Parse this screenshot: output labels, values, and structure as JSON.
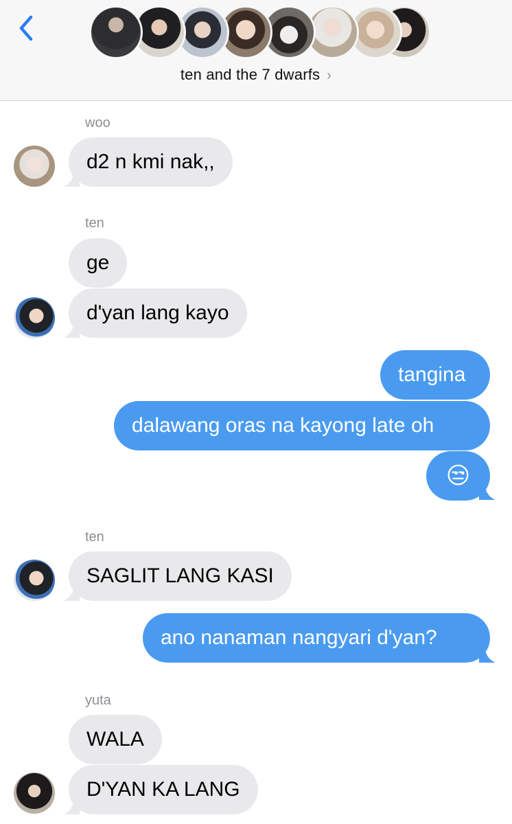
{
  "header": {
    "group_name": "ten and the 7 dwarfs",
    "chevron": "›",
    "member_avatars": [
      "avatar-1",
      "avatar-2",
      "avatar-3",
      "avatar-4",
      "avatar-5",
      "avatar-6",
      "avatar-7",
      "avatar-8"
    ]
  },
  "messages": [
    {
      "sender": "woo",
      "text": "d2 n kmi nak,,"
    },
    {
      "sender": "ten",
      "text": "ge"
    },
    {
      "text": "d'yan lang kayo"
    },
    {
      "text": "tangina"
    },
    {
      "text": "dalawang oras na kayong late oh"
    },
    {
      "text": "😒"
    },
    {
      "sender": "ten",
      "text": "SAGLIT LANG KASI"
    },
    {
      "text": "ano nanaman nangyari d'yan?"
    },
    {
      "sender": "yuta",
      "text": "WALA"
    },
    {
      "text": "D'YAN KA LANG"
    }
  ],
  "colors": {
    "incoming_bubble": "#e9e9eb",
    "outgoing_bubble": "#4a9bf0",
    "accent": "#2d7cf6",
    "header_bg": "#f7f7f7"
  },
  "icons": {
    "back": "chevron-left-icon",
    "group_chevron": "chevron-right-icon"
  }
}
